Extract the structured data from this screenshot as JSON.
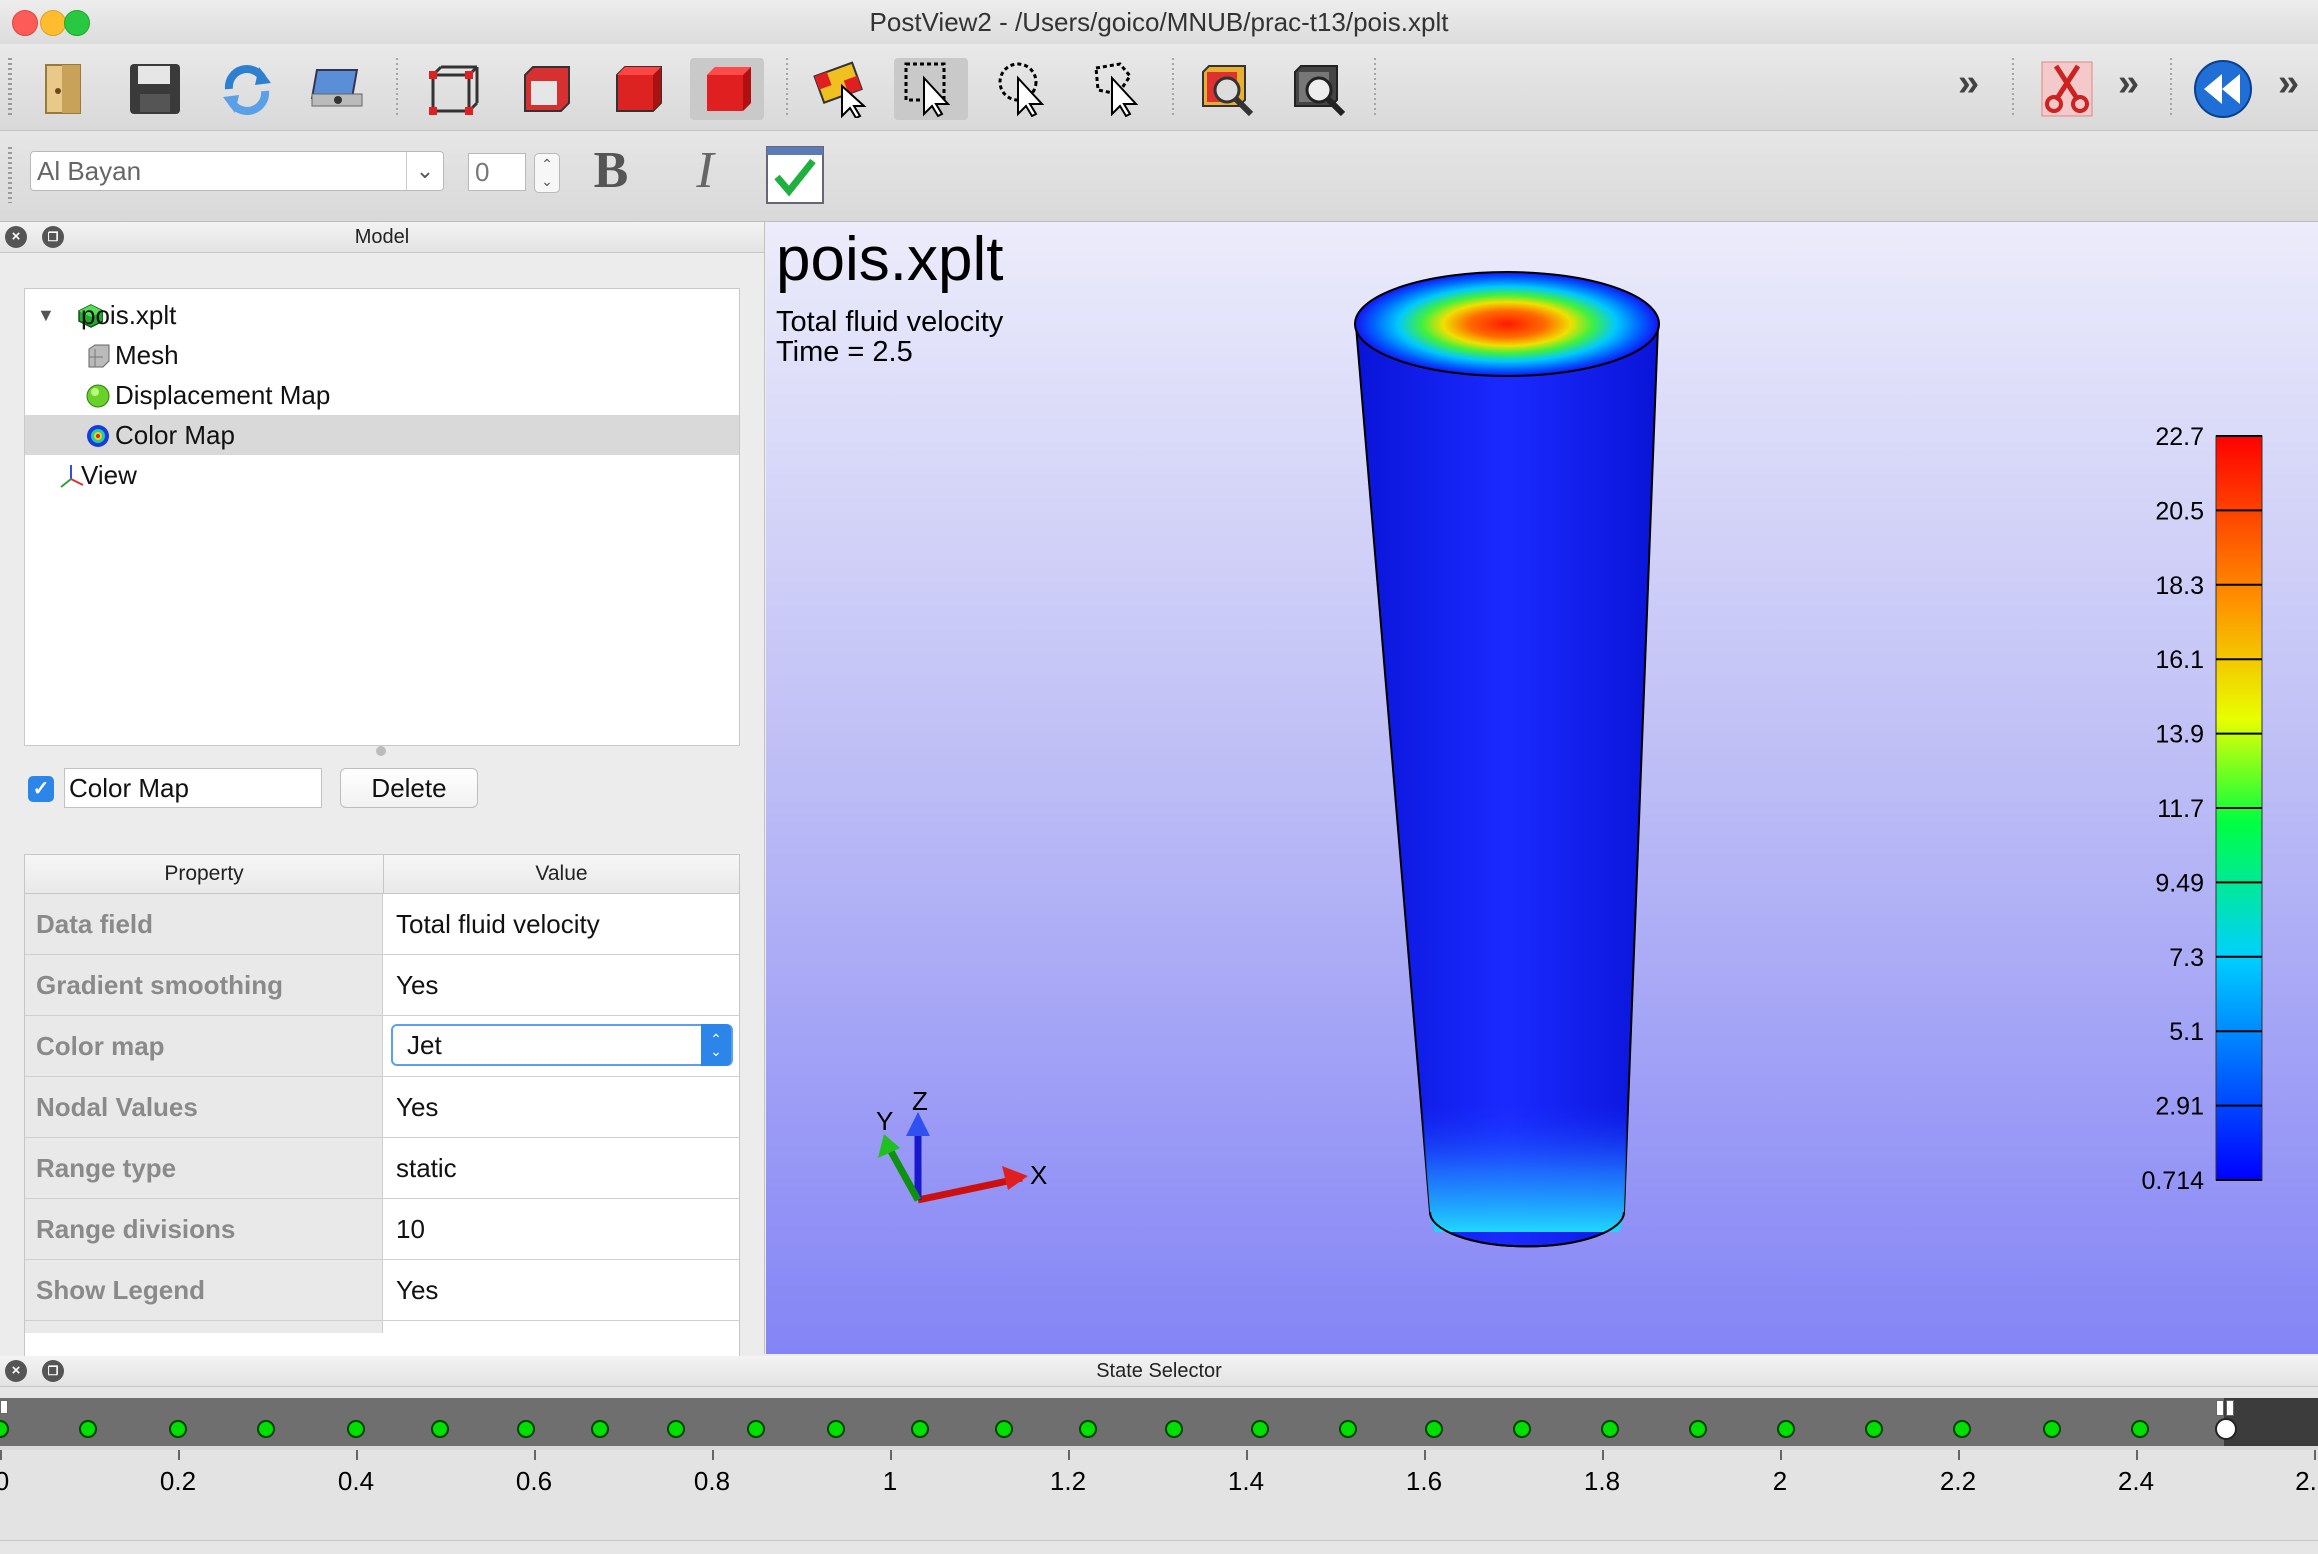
{
  "window": {
    "title": "PostView2 - /Users/goico/MNUB/prac-t13/pois.xplt"
  },
  "toolbar": {
    "buttons": [
      "open-icon",
      "save-icon",
      "refresh-icon",
      "snapshot-icon",
      "wireframe-box-icon",
      "outline-box-icon",
      "solid-box-icon",
      "solid-box-active-icon",
      "select-elements-icon",
      "select-rect-icon",
      "select-circle-icon",
      "select-freehand-icon",
      "zoom-selection-icon",
      "zoom-extents-icon"
    ],
    "overflow": "»",
    "overflow2": "»",
    "overflow3": "»"
  },
  "font_toolbar": {
    "font_name": "Al Bayan",
    "font_size": "0",
    "bold": "B",
    "italic": "I"
  },
  "model_panel": {
    "title": "Model",
    "tree": [
      {
        "label": "pois.xplt",
        "icon": "model-icon"
      },
      {
        "label": "Mesh",
        "icon": "mesh-icon"
      },
      {
        "label": "Displacement Map",
        "icon": "displacement-icon"
      },
      {
        "label": "Color Map",
        "icon": "colormap-icon"
      },
      {
        "label": "View",
        "icon": "axes-icon"
      }
    ],
    "selected_name": "Color Map",
    "delete_label": "Delete",
    "props_header": {
      "property": "Property",
      "value": "Value"
    },
    "props": [
      {
        "name": "Data field",
        "value": "Total fluid velocity"
      },
      {
        "name": "Gradient smoothing",
        "value": "Yes"
      },
      {
        "name": "Color map",
        "value": "Jet"
      },
      {
        "name": "Nodal Values",
        "value": "Yes"
      },
      {
        "name": "Range type",
        "value": "static"
      },
      {
        "name": "Range divisions",
        "value": "10"
      },
      {
        "name": "Show Legend",
        "value": "Yes"
      }
    ]
  },
  "viewport": {
    "title": "pois.xplt",
    "subtitle1": "Total fluid velocity",
    "subtitle2": "Time = 2.5",
    "axes": {
      "x": "X",
      "y": "Y",
      "z": "Z"
    },
    "legend_labels": [
      "22.7",
      "20.5",
      "18.3",
      "16.1",
      "13.9",
      "11.7",
      "9.49",
      "7.3",
      "5.1",
      "2.91",
      "0.714"
    ]
  },
  "state_selector": {
    "title": "State Selector",
    "ruler_labels": [
      "0",
      "0.2",
      "0.4",
      "0.6",
      "0.8",
      "1",
      "1.2",
      "1.4",
      "1.6",
      "1.8",
      "2",
      "2.2",
      "2.4",
      "2."
    ],
    "current_time": 2.5
  },
  "colors": {
    "accent": "#2c86ea",
    "state_dot": "#00e000",
    "jet_top": "#ff0000",
    "jet_bottom": "#0000ff"
  }
}
